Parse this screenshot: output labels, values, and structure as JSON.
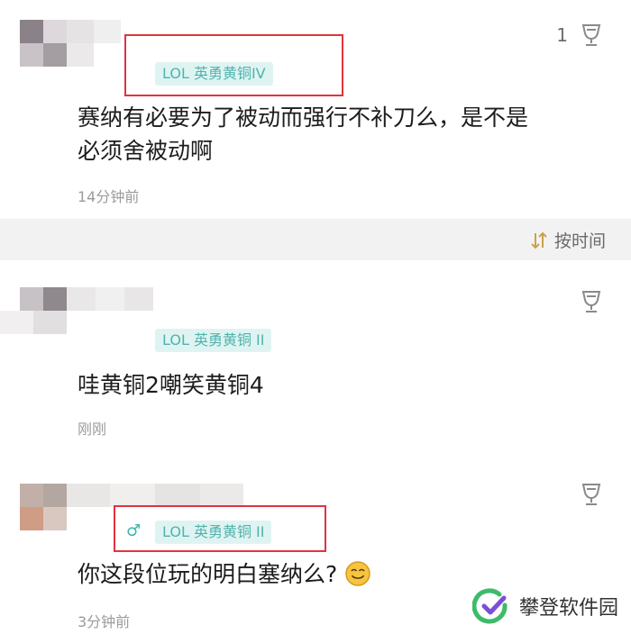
{
  "comments": [
    {
      "badge": "LOL 英勇黄铜IV",
      "content_line1": "赛纳有必要为了被动而强行不补刀么，是不是",
      "content_line2": "必须舍被动啊",
      "time": "14分钟前",
      "like_count": "1"
    },
    {
      "badge": "LOL 英勇黄铜 II",
      "content": "哇黄铜2嘲笑黄铜4",
      "time": "刚刚",
      "like_count": ""
    },
    {
      "gender": "♂",
      "badge": "LOL 英勇黄铜 II",
      "content": "你这段位玩的明白塞纳么?",
      "time": "3分钟前",
      "like_count": ""
    }
  ],
  "sort": {
    "label": "按时间"
  },
  "watermark": {
    "text": "攀登软件园"
  },
  "colors": {
    "badge_bg": "#dff4f2",
    "badge_text": "#4fb3ad",
    "highlight_box": "#e0333f"
  },
  "icons": [
    "trophy-cup-icon",
    "sort-arrows-icon",
    "smile-emoji-icon",
    "watermark-logo-icon"
  ]
}
